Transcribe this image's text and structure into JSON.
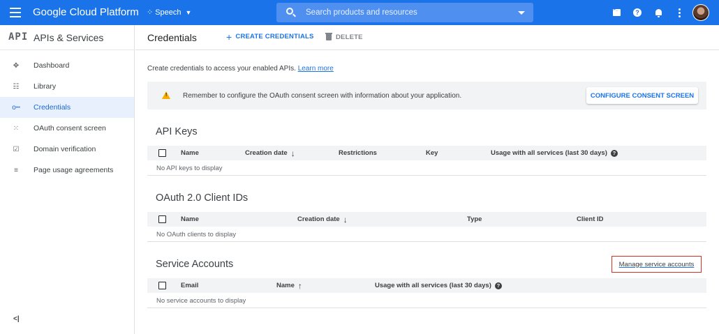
{
  "topbar": {
    "brand": "Google Cloud Platform",
    "project": "Speech",
    "search_placeholder": "Search products and resources",
    "bg_color": "#1a73e8"
  },
  "sidebar": {
    "logo": "API",
    "title": "APIs & Services",
    "items": [
      {
        "label": "Dashboard",
        "icon": "dashboard-icon",
        "active": false
      },
      {
        "label": "Library",
        "icon": "library-icon",
        "active": false
      },
      {
        "label": "Credentials",
        "icon": "key-icon",
        "active": true
      },
      {
        "label": "OAuth consent screen",
        "icon": "grid-dots-icon",
        "active": false
      },
      {
        "label": "Domain verification",
        "icon": "checkbox-icon",
        "active": false
      },
      {
        "label": "Page usage agreements",
        "icon": "list-settings-icon",
        "active": false
      }
    ],
    "collapse_label": "<|"
  },
  "header": {
    "title": "Credentials",
    "create_label": "CREATE CREDENTIALS",
    "delete_label": "DELETE"
  },
  "intro": {
    "text": "Create credentials to access your enabled APIs.",
    "link": "Learn more"
  },
  "banner": {
    "text": "Remember to configure the OAuth consent screen with information about your application.",
    "button": "CONFIGURE CONSENT SCREEN"
  },
  "api_keys": {
    "title": "API Keys",
    "columns": [
      "Name",
      "Creation date",
      "Restrictions",
      "Key",
      "Usage with all services (last 30 days)"
    ],
    "empty": "No API keys to display"
  },
  "oauth": {
    "title": "OAuth 2.0 Client IDs",
    "columns": [
      "Name",
      "Creation date",
      "Type",
      "Client ID"
    ],
    "empty": "No OAuth clients to display"
  },
  "service_accounts": {
    "title": "Service Accounts",
    "manage_link": "Manage service accounts",
    "columns": [
      "Email",
      "Name",
      "Usage with all services (last 30 days)"
    ],
    "empty": "No service accounts to display"
  },
  "colors": {
    "accent": "#1a73e8",
    "warning": "#f9ab00",
    "highlight_border": "#d93025"
  }
}
